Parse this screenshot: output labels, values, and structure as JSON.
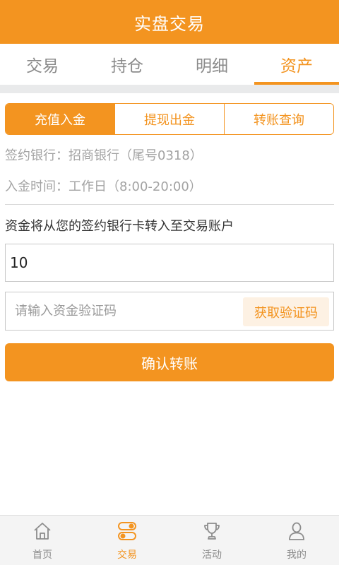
{
  "header": {
    "title": "实盘交易"
  },
  "tabs": [
    {
      "label": "交易",
      "active": false
    },
    {
      "label": "持仓",
      "active": false
    },
    {
      "label": "明细",
      "active": false
    },
    {
      "label": "资产",
      "active": true
    }
  ],
  "segments": [
    {
      "label": "充值入金",
      "active": true
    },
    {
      "label": "提现出金",
      "active": false
    },
    {
      "label": "转账查询",
      "active": false
    }
  ],
  "info": {
    "bank": "签约银行：招商银行（尾号0318）",
    "hours": "入金时间：工作日（8:00-20:00）"
  },
  "description": "资金将从您的签约银行卡转入至交易账户",
  "amount": {
    "value": "10"
  },
  "code": {
    "placeholder": "请输入资金验证码",
    "button": "获取验证码"
  },
  "confirm_label": "确认转账",
  "bottom_nav": [
    {
      "label": "首页",
      "icon": "home-icon",
      "active": false
    },
    {
      "label": "交易",
      "icon": "toggle-icon",
      "active": true
    },
    {
      "label": "活动",
      "icon": "trophy-icon",
      "active": false
    },
    {
      "label": "我的",
      "icon": "user-icon",
      "active": false
    }
  ],
  "colors": {
    "accent": "#f39420",
    "accent_light": "#fdf1e3",
    "muted": "#a3a3a3"
  }
}
